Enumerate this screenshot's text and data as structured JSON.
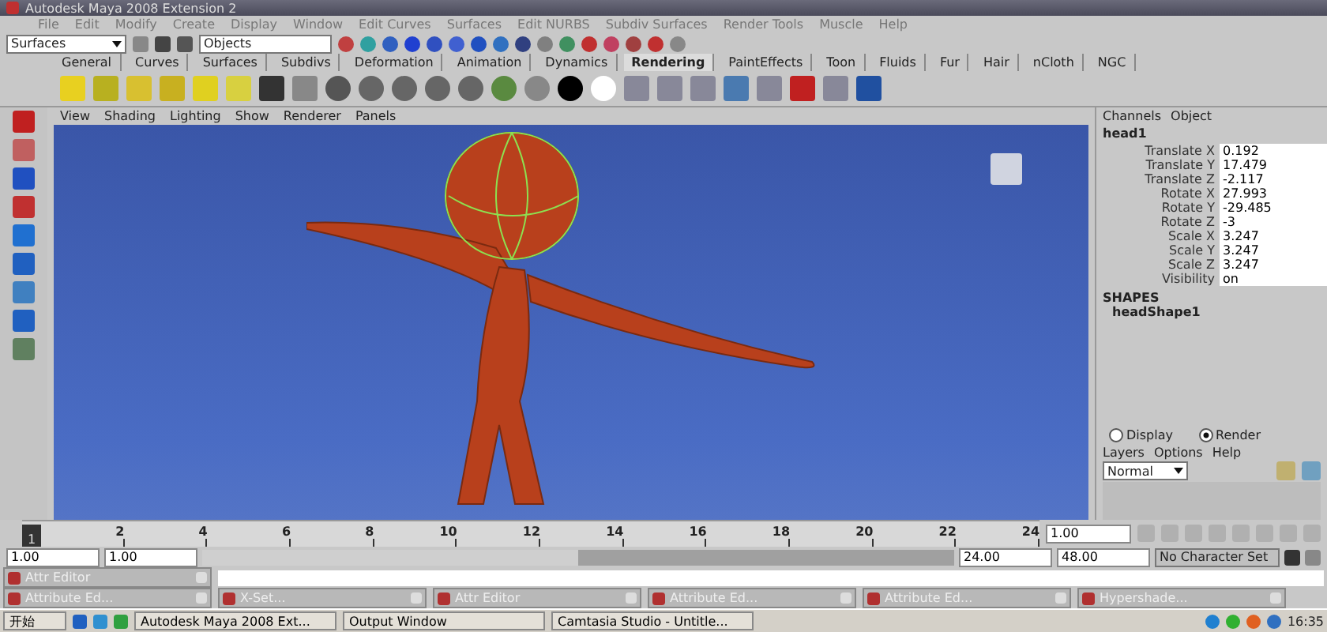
{
  "window": {
    "title": "Autodesk Maya 2008 Extension 2"
  },
  "menu": [
    "File",
    "Edit",
    "Modify",
    "Create",
    "Display",
    "Window",
    "Edit Curves",
    "Surfaces",
    "Edit NURBS",
    "Subdiv Surfaces",
    "Render Tools",
    "Muscle",
    "Help"
  ],
  "status_line": {
    "mode": "Surfaces",
    "selection_mode": "Objects"
  },
  "shelf_tabs": [
    {
      "label": "General",
      "selected": false
    },
    {
      "label": "Curves",
      "selected": false
    },
    {
      "label": "Surfaces",
      "selected": false
    },
    {
      "label": "Subdivs",
      "selected": false
    },
    {
      "label": "Deformation",
      "selected": false
    },
    {
      "label": "Animation",
      "selected": false
    },
    {
      "label": "Dynamics",
      "selected": false
    },
    {
      "label": "Rendering",
      "selected": true
    },
    {
      "label": "PaintEffects",
      "selected": false
    },
    {
      "label": "Toon",
      "selected": false
    },
    {
      "label": "Fluids",
      "selected": false
    },
    {
      "label": "Fur",
      "selected": false
    },
    {
      "label": "Hair",
      "selected": false
    },
    {
      "label": "nCloth",
      "selected": false
    },
    {
      "label": "NGC",
      "selected": false
    }
  ],
  "viewport_menu": [
    "View",
    "Shading",
    "Lighting",
    "Show",
    "Renderer",
    "Panels"
  ],
  "channel_box": {
    "tabs": [
      "Channels",
      "Object"
    ],
    "node": "head1",
    "attributes": [
      {
        "name": "Translate X",
        "value": "0.192"
      },
      {
        "name": "Translate Y",
        "value": "17.479"
      },
      {
        "name": "Translate Z",
        "value": "-2.117"
      },
      {
        "name": "Rotate X",
        "value": "27.993"
      },
      {
        "name": "Rotate Y",
        "value": "-29.485"
      },
      {
        "name": "Rotate Z",
        "value": "-3"
      },
      {
        "name": "Scale X",
        "value": "3.247"
      },
      {
        "name": "Scale Y",
        "value": "3.247"
      },
      {
        "name": "Scale Z",
        "value": "3.247"
      },
      {
        "name": "Visibility",
        "value": "on"
      }
    ],
    "shapes_heading": "SHAPES",
    "shape": "headShape1"
  },
  "layer_editor": {
    "modes": [
      {
        "label": "Display",
        "selected": false
      },
      {
        "label": "Render",
        "selected": true
      }
    ],
    "menu": [
      "Layers",
      "Options",
      "Help"
    ],
    "blend": "Normal"
  },
  "timeline": {
    "level": 0,
    "ticks": [
      "2",
      "4",
      "6",
      "8",
      "10",
      "12",
      "14",
      "16",
      "18",
      "20",
      "22",
      "24"
    ],
    "current": "1",
    "current_field": "1.00"
  },
  "range": {
    "level": 0.5,
    "start": "1.00",
    "range_start": "1.00",
    "range_end": "24.00",
    "end": "48.00",
    "character_set": "No Character Set"
  },
  "minimized_windows": [
    [
      {
        "title": "Attr Editor"
      }
    ],
    [
      {
        "title": "Attribute Ed..."
      },
      {
        "title": "X-Set..."
      },
      {
        "title": "Attr Editor"
      },
      {
        "title": "Attribute Ed..."
      },
      {
        "title": "Attribute Ed..."
      },
      {
        "title": "Hypershade..."
      }
    ]
  ],
  "taskbar": {
    "start": "开始",
    "tasks": [
      "Autodesk Maya 2008 Ext...",
      "Output Window",
      "Camtasia Studio - Untitle..."
    ],
    "clock": "16:35"
  }
}
